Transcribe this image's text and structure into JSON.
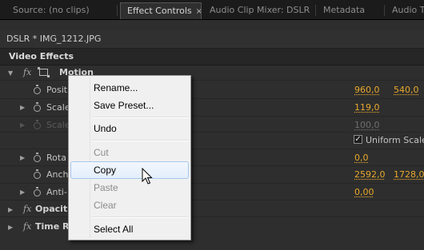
{
  "tabs": [
    {
      "label": "Source: (no clips)"
    },
    {
      "label": "Effect Controls",
      "close": "×"
    },
    {
      "label": "Audio Clip Mixer: DSLR"
    },
    {
      "label": "Metadata"
    },
    {
      "label": "Audio T"
    }
  ],
  "clip": {
    "title": "DSLR * IMG_1212.JPG"
  },
  "section": {
    "title": "Video Effects"
  },
  "effects": {
    "fx_glyph": "fx",
    "motion": "Motion",
    "opacity": "Opacit",
    "time_remap": "Time R"
  },
  "params": {
    "position": {
      "label": "Posit",
      "v1": "960,0",
      "v2": "540,0"
    },
    "scale": {
      "label": "Scale",
      "v1": "119,0"
    },
    "scale_width": {
      "label": "Scale",
      "v1": "100,0"
    },
    "uniform_scale": {
      "label": "Uniform Scale",
      "checked": "✓"
    },
    "rotation": {
      "label": "Rota",
      "v1": "0,0"
    },
    "anchor": {
      "label": "Anch",
      "v1": "2592,0",
      "v2": "1728,0"
    },
    "anti_flicker": {
      "label": "Anti-",
      "v1": "0,00"
    }
  },
  "context_menu": {
    "rename": "Rename...",
    "save_preset": "Save Preset...",
    "undo": "Undo",
    "cut": "Cut",
    "copy": "Copy",
    "paste": "Paste",
    "clear": "Clear",
    "select_all": "Select All"
  },
  "colors": {
    "value": "#e8a82b",
    "menu_hover": "#a8c8ec"
  }
}
